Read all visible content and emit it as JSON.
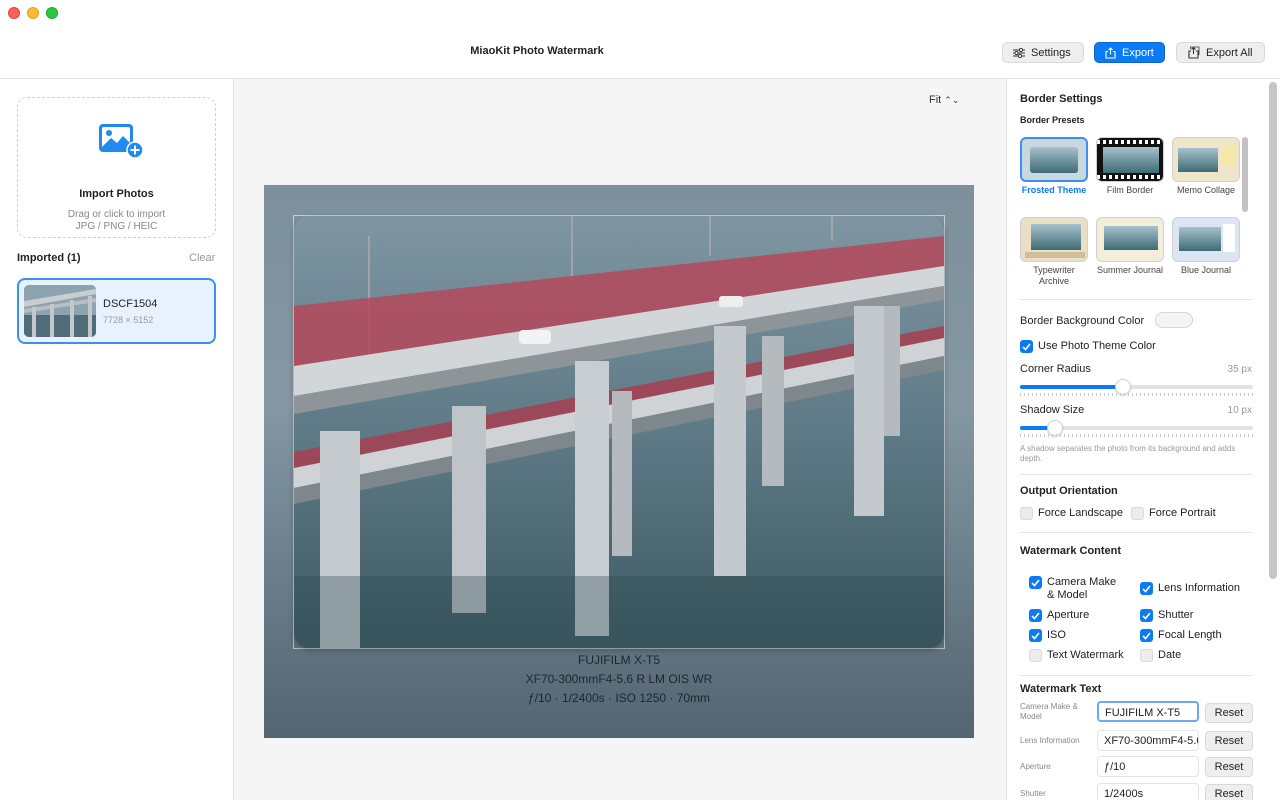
{
  "app": {
    "title": "MiaoKit Photo Watermark"
  },
  "toolbar": {
    "settings_label": "Settings",
    "export_label": "Export",
    "export_all_label": "Export All"
  },
  "sidebar": {
    "import": {
      "title": "Import Photos",
      "line1": "Drag or click to import",
      "line2": "JPG / PNG / HEIC"
    },
    "imported_label": "Imported (1)",
    "clear_label": "Clear",
    "photos": [
      {
        "name": "DSCF1504",
        "dims": "7728 × 5152"
      }
    ]
  },
  "preview": {
    "zoom_label": "Fit",
    "watermark": {
      "line1": "FUJIFILM X-T5",
      "line2": "XF70-300mmF4-5.6 R LM OIS WR",
      "line3": "ƒ/10  ·  1/2400s  ·  ISO 1250  ·  70mm"
    }
  },
  "panel": {
    "border_settings_title": "Border Settings",
    "border_presets_title": "Border Presets",
    "presets": [
      {
        "label": "Frosted Theme",
        "selected": true
      },
      {
        "label": "Film Border",
        "selected": false
      },
      {
        "label": "Memo Collage",
        "selected": false
      },
      {
        "label": "Typewriter Archive",
        "selected": false
      },
      {
        "label": "Summer Journal",
        "selected": false
      },
      {
        "label": "Blue Journal",
        "selected": false
      }
    ],
    "bg_color_label": "Border Background Color",
    "use_theme_color_label": "Use Photo Theme Color",
    "use_theme_color_checked": true,
    "corner_radius_label": "Corner Radius",
    "corner_radius_value": "35 px",
    "corner_radius_fraction": 0.44,
    "shadow_size_label": "Shadow Size",
    "shadow_size_value": "10 px",
    "shadow_size_fraction": 0.15,
    "shadow_hint": "A shadow separates the photo from its background and adds depth.",
    "orientation_title": "Output Orientation",
    "force_landscape_label": "Force Landscape",
    "force_portrait_label": "Force Portrait",
    "watermark_content_title": "Watermark Content",
    "content_checks": [
      {
        "label": "Camera Make & Model",
        "checked": true
      },
      {
        "label": "Lens Information",
        "checked": true
      },
      {
        "label": "Aperture",
        "checked": true
      },
      {
        "label": "Shutter",
        "checked": true
      },
      {
        "label": "ISO",
        "checked": true
      },
      {
        "label": "Focal Length",
        "checked": true
      },
      {
        "label": "Text Watermark",
        "checked": false
      },
      {
        "label": "Date",
        "checked": false
      }
    ],
    "watermark_text_title": "Watermark Text",
    "reset_label": "Reset",
    "text_fields": [
      {
        "label": "Camera Make & Model",
        "value": "FUJIFILM X-T5"
      },
      {
        "label": "Lens Information",
        "value": "XF70-300mmF4-5.6 R LM OIS WR"
      },
      {
        "label": "Aperture",
        "value": "ƒ/10"
      },
      {
        "label": "Shutter",
        "value": "1/2400s"
      }
    ]
  },
  "colors": {
    "accent": "#0a7bf2",
    "selection_bg": "#e8f2fe"
  }
}
